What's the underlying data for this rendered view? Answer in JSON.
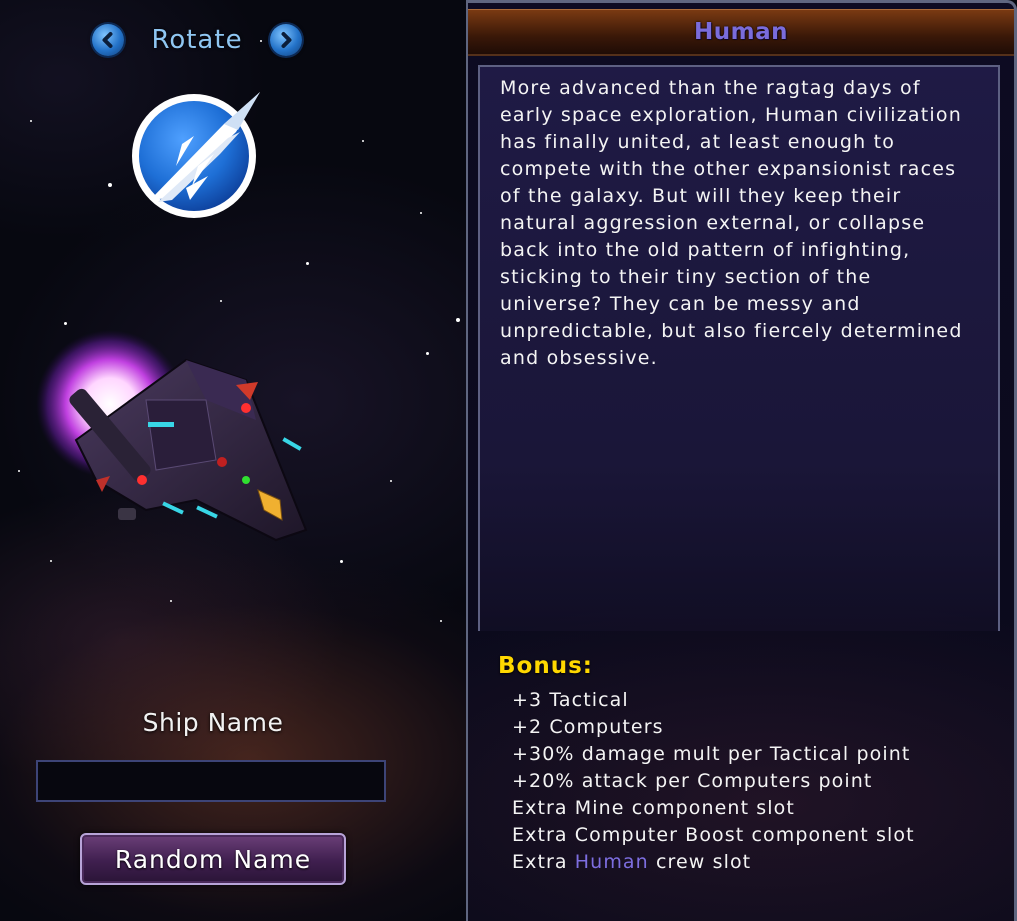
{
  "rotate": {
    "label": "Rotate",
    "left_icon": "chevron-left-icon",
    "right_icon": "chevron-right-icon"
  },
  "emblem": {
    "icon": "human-race-emblem-icon",
    "accent": "#1e6fd6"
  },
  "ship_name": {
    "label": "Ship Name",
    "value": "",
    "random_button_label": "Random Name"
  },
  "race": {
    "title": "Human",
    "title_color": "#7a6cdc",
    "description": "More advanced than the ragtag days of early space exploration, Human civilization has finally united, at least enough to compete with the other expansionist races of the galaxy. But will they keep their natural aggression external, or collapse back into the old pattern of infighting, sticking to their tiny section of the universe? They can be messy and unpredictable, but also fiercely determined and obsessive."
  },
  "bonus": {
    "heading": "Bonus:",
    "heading_color": "#ffd800",
    "items": [
      "+3 Tactical",
      "+2 Computers",
      "+30% damage mult per Tactical point",
      "+20% attack per Computers point",
      "Extra Mine component slot",
      "Extra Computer Boost component slot"
    ],
    "crew_slot": {
      "prefix": "Extra ",
      "race": "Human",
      "suffix": " crew slot"
    }
  }
}
